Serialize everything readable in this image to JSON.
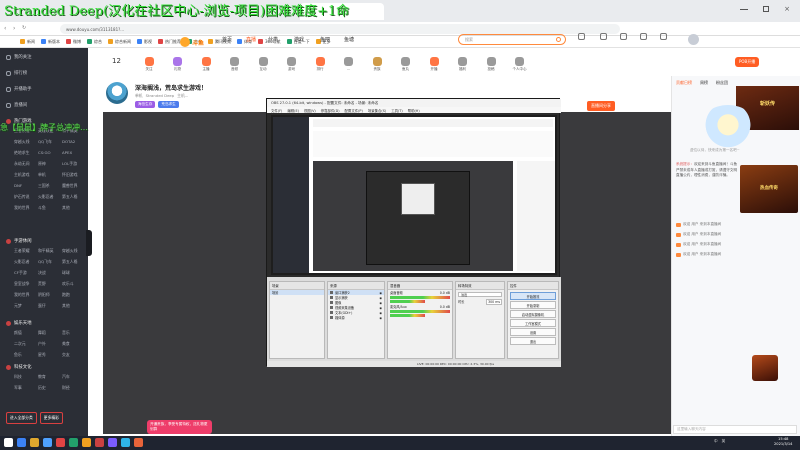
{
  "overlay_title": "Stranded Deep(汉化在社区中心-浏览-项目)困难难度+1命",
  "marquee": "急【鼠鼠】牌子总冲冲…",
  "browser": {
    "active_tab": "...",
    "url": "www.douyu.com/3113181?...",
    "bookmarks": [
      "新闻",
      "新版本",
      "微博",
      "综合",
      "综合新闻",
      "影视",
      "热门推荐",
      "京东",
      "腾讯视频",
      "体育",
      "360导航",
      "百度一下",
      "更多"
    ]
  },
  "site": {
    "logo": "斗鱼",
    "nav": [
      "首页",
      "直播",
      "分类",
      "游戏",
      "鱼吧",
      "鱼塘"
    ],
    "search_placeholder": "搜索",
    "open_live": "POB开播"
  },
  "toolbar": {
    "count": "12",
    "items": [
      "关注",
      "礼物",
      "主播",
      "音频",
      "互动",
      "游戏",
      "排行",
      "...",
      "贵族",
      "鱼丸",
      "开播",
      "福利",
      "投稿",
      "个人中心"
    ]
  },
  "room": {
    "title": "深海搁浅，荒岛求生游戏！",
    "meta": [
      "单机",
      "Stranded Deep",
      "主机..."
    ],
    "tags": [
      "海岛生存",
      "荒岛求生"
    ],
    "share": "直播间分享"
  },
  "sidebar": {
    "top_items": [
      "我的关注",
      "排行榜",
      "开播助手",
      "直播间"
    ],
    "section1": "热门游戏",
    "section1_grid": [
      "王者荣耀",
      "英雄联盟",
      "和平精英",
      "穿越火线",
      "QQ飞车",
      "DOTA2",
      "绝地求生",
      "CS:GO",
      "APEX",
      "永劫无间",
      "原神",
      "LOL手游",
      "主机游戏",
      "单机",
      "怀旧游戏",
      "DNF",
      "三国杀",
      "魔兽世界",
      "炉石传说",
      "火影忍者",
      "第五人格",
      "我的世界",
      "斗鱼",
      "其他"
    ],
    "section2": "手游休闲",
    "section2_grid": [
      "王者荣耀",
      "和平精英",
      "穿越火线",
      "火影忍者",
      "QQ飞车",
      "第五人格",
      "CF手游",
      "决战",
      "球球",
      "皇室战争",
      "荒野",
      "欢乐斗",
      "我的世界",
      "阴阳师",
      "跑跑",
      "元梦",
      "蛋仔",
      "其他"
    ],
    "section3": "娱乐天地",
    "section3_grid": [
      "颜值",
      "舞蹈",
      "音乐",
      "二次元",
      "户外",
      "美食",
      "鱼乐",
      "星秀",
      "交友"
    ],
    "section4": "科技文化",
    "section4_grid": [
      "科技",
      "教育",
      "汽车",
      "军事",
      "历史",
      "财经"
    ],
    "btn_a": "进入全部分类",
    "btn_b": "更多精彩"
  },
  "obs": {
    "title": "OBS 27.0.1 (64-bit, windows) - 配置文件: 未命名 - 场景: 未命名",
    "menu": [
      "文件(F)",
      "编辑(E)",
      "视图(V)",
      "停靠部件(D)",
      "配置文件(P)",
      "场景集合(S)",
      "工具(T)",
      "帮助(H)"
    ],
    "docks": {
      "scenes": "场景",
      "sources": "来源",
      "mixer": "混音器",
      "transitions": "转场特效",
      "controls": "控件"
    },
    "sources": [
      "窗口捕获2",
      "显示捕获",
      "图像",
      "视频采集设备",
      "文本(GDI+)",
      "媒体源"
    ],
    "scene": "场景",
    "mixer_tracks": [
      "桌面音频",
      "麦克风/Aux"
    ],
    "mixer_db": [
      "0.0 dB",
      "0.0 dB"
    ],
    "transition": "淡出",
    "duration_label": "时长",
    "duration_value": "300 ms",
    "controls": [
      "开始推流",
      "开始录制",
      "启动虚拟摄像机",
      "工作室模式",
      "设置",
      "退出"
    ],
    "status": "LIVE: 00:00:00   REC: 00:00:00   CPU: 2.3%, 30.00 fps"
  },
  "right_panel": {
    "tabs": [
      "贡献日榜",
      "周榜",
      "粉丝团"
    ],
    "empty_text": "虚位以待，快来成为第一名吧~",
    "chat": [
      {
        "user": "系统提示：",
        "text": "欢迎来到斗鱼直播间！斗鱼严禁未成年人直播或打赏，请遵守文明直播公约，理性消费，谨防诈骗。"
      }
    ],
    "sys": [
      "欢迎 用户 来到本直播间",
      "欢迎 用户 来到本直播间",
      "欢迎 用户 来到本直播间",
      "欢迎 用户 来到本直播间"
    ],
    "ad": "斩妖传",
    "ad2": "热血传奇",
    "input_placeholder": "这里输入聊天内容"
  },
  "gift_tip": "开通贵族，享受专属特权，送礼物更划算",
  "taskbar": {
    "time": "15:48",
    "date": "2021/3/14",
    "tray": [
      "中",
      "英"
    ]
  },
  "colors": {
    "accent": "#ff5d23",
    "overlay_green": "#37e03a",
    "sidebar": "#2b2e36",
    "player": "#3a3a3d"
  }
}
